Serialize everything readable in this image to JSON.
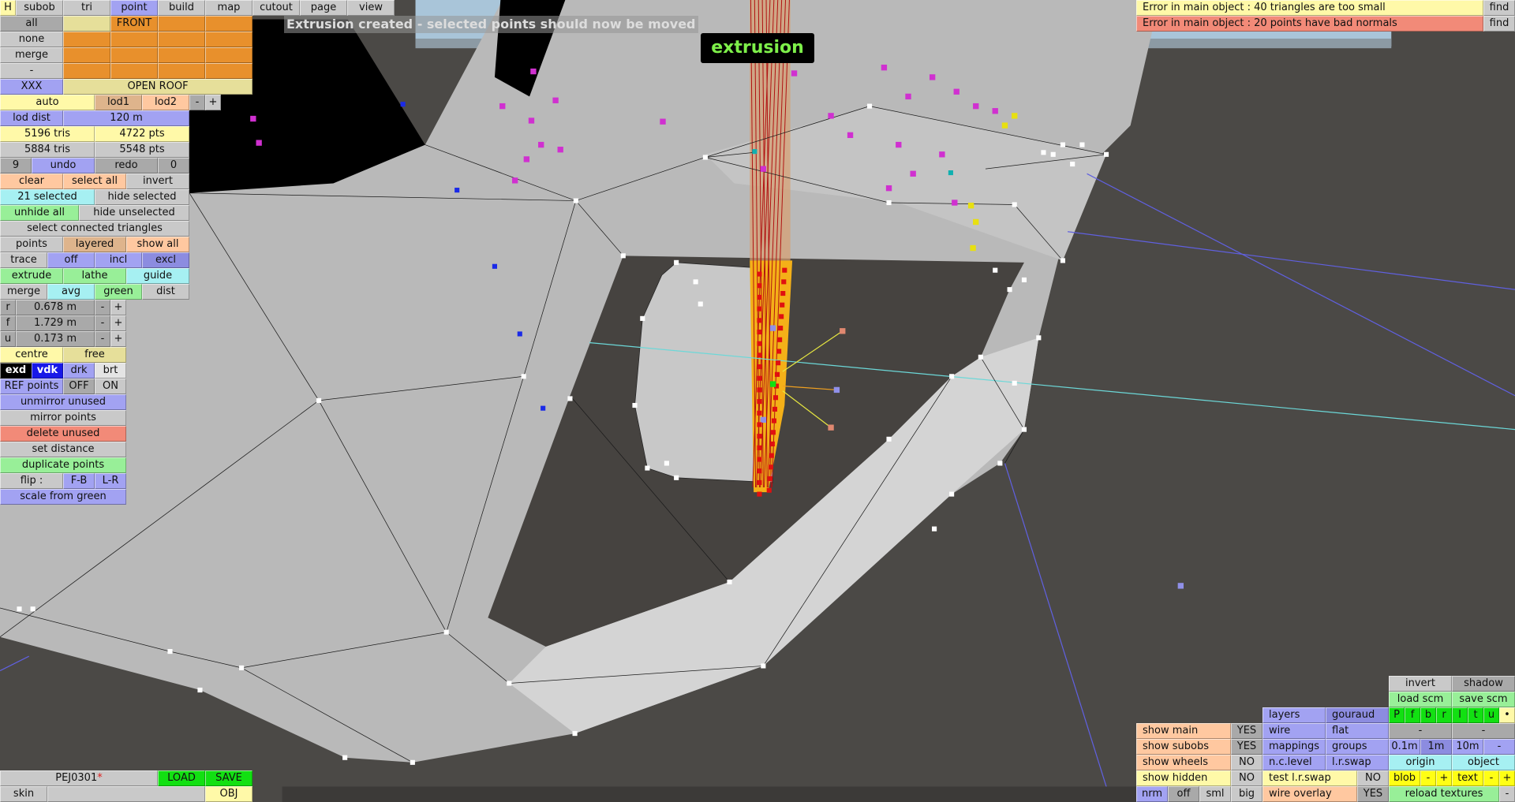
{
  "menu": [
    "H",
    "subob",
    "tri",
    "point",
    "build",
    "map",
    "cutout",
    "page",
    "view"
  ],
  "select_grid": {
    "all": "all",
    "none": "none",
    "merge": "merge",
    "dash": "-",
    "front": "FRONT",
    "xxx": "XXX",
    "open_roof": "OPEN ROOF"
  },
  "lod": {
    "auto": "auto",
    "lod1": "lod1",
    "lod2": "lod2",
    "minus": "-",
    "plus": "+",
    "dist_label": "lod dist",
    "dist_value": "120 m"
  },
  "stats": {
    "tris_a": "5196 tris",
    "pts_a": "4722 pts",
    "tris_b": "5884 tris",
    "pts_b": "5548 pts"
  },
  "history": {
    "undo_count": "9",
    "undo": "undo",
    "redo": "redo",
    "redo_count": "0"
  },
  "selection": {
    "clear": "clear",
    "select_all": "select all",
    "invert": "invert",
    "selected": "21 selected",
    "hide_selected": "hide selected",
    "unhide_all": "unhide all",
    "hide_unselected": "hide unselected",
    "select_connected": "select connected triangles"
  },
  "display": {
    "points": "points",
    "layered": "layered",
    "show_all": "show all",
    "trace": "trace",
    "off": "off",
    "incl": "incl",
    "excl": "excl"
  },
  "tools": {
    "extrude": "extrude",
    "lathe": "lathe",
    "guide": "guide",
    "merge": "merge",
    "avg": "avg",
    "green": "green",
    "dist": "dist"
  },
  "coords": [
    {
      "axis": "r",
      "value": "0.678 m"
    },
    {
      "axis": "f",
      "value": "1.729 m"
    },
    {
      "axis": "u",
      "value": "0.173 m"
    }
  ],
  "coord_minus": "-",
  "coord_plus": "+",
  "pivot": {
    "centre": "centre",
    "free": "free"
  },
  "brightness": {
    "exd": "exd",
    "vdk": "vdk",
    "drk": "drk",
    "brt": "brt"
  },
  "ref": {
    "label": "REF points",
    "off": "OFF",
    "on": "ON"
  },
  "actions": {
    "unmirror": "unmirror unused",
    "mirror": "mirror points",
    "delete_unused": "delete unused",
    "set_distance": "set distance",
    "duplicate": "duplicate points",
    "flip": "flip :",
    "fb": "F-B",
    "lr": "L-R",
    "scale": "scale from green"
  },
  "file": {
    "name": "PEJ0301",
    "modified_mark": "*",
    "load": "LOAD",
    "save": "SAVE",
    "skin": "skin",
    "skin_value": "",
    "obj": "OBJ"
  },
  "status_message": "Extrusion created - selected points should now be moved",
  "mode_tag": "extrusion",
  "errors": [
    {
      "text": "Error in main object : 40 triangles are too small",
      "find": "find",
      "color": "#fff9a8"
    },
    {
      "text": "Error in main object : 20 points have bad normals",
      "find": "find",
      "color": "#f28a78"
    }
  ],
  "view_panel": {
    "invert": "invert",
    "shadow": "shadow",
    "load_scm": "load scm",
    "save_scm": "save scm",
    "layers": "layers",
    "gouraud": "gouraud",
    "wire": "wire",
    "flat": "flat",
    "mappings": "mappings",
    "groups": "groups",
    "nc_level": "n.c.level",
    "lr_swap": "l.r.swap",
    "views": [
      "P",
      "f",
      "b",
      "r",
      "l",
      "t",
      "u",
      "•"
    ],
    "dash": "-",
    "grid": [
      "0.1m",
      "1m",
      "10m",
      "-"
    ],
    "origin": "origin",
    "object": "object",
    "blob": "blob",
    "text": "text",
    "minus": "-",
    "plus": "+",
    "reload": "reload textures",
    "reload_minus": "-",
    "show_main": "show main",
    "show_main_v": "YES",
    "show_subobs": "show subobs",
    "show_subobs_v": "YES",
    "show_wheels": "show wheels",
    "show_wheels_v": "NO",
    "show_hidden": "show hidden",
    "show_hidden_v": "NO",
    "test_swap": "test l.r.swap",
    "test_swap_v": "NO",
    "size": [
      "nrm",
      "off",
      "sml",
      "big"
    ],
    "wire_overlay": "wire overlay",
    "wire_overlay_v": "YES"
  }
}
